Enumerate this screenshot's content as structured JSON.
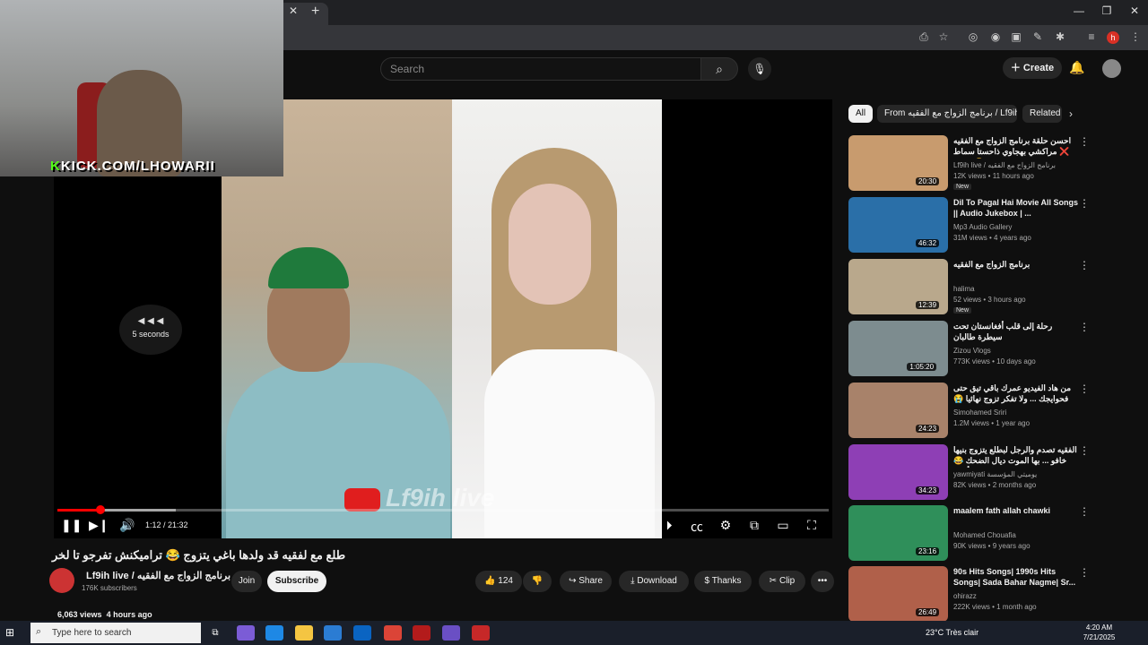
{
  "browser": {
    "tab_close": "✕",
    "new_tab": "+",
    "min": "—",
    "restore": "❐",
    "close": "✕",
    "profile_initial": "h"
  },
  "header": {
    "search_placeholder": "Search",
    "create_label": "Create"
  },
  "webcam": {
    "label_k": "K",
    "label_rest": "KICK.COM/LHOWARII"
  },
  "player": {
    "watermark": "Lf9ih live",
    "seek_arrows": "◀ ◀ ◀",
    "seek_label": "5 seconds",
    "time": "1:12 / 21:32",
    "progress_played": 0.056,
    "progress_buffered": 0.154
  },
  "video": {
    "title": "طلع مع لفقيه قد ولدها باغي يتزوج 😂 تراميكنش تفرجو تا لخر",
    "channel_name": "Lf9ih live / برنامج الزواج مع الفقيه",
    "subscribers": "176K subscribers",
    "join_label": "Join",
    "subscribe_label": "Subscribe",
    "likes": "124",
    "share_label": "Share",
    "download_label": "Download",
    "thanks_label": "Thanks",
    "clip_label": "Clip",
    "more_label": "•••",
    "views": "6,063 views",
    "age": "4 hours ago"
  },
  "sidebar": {
    "chips": [
      {
        "label": "All"
      },
      {
        "label": "From برنامج الزواج مع الفقيه / Lf9ih live"
      },
      {
        "label": "Related"
      }
    ],
    "recommendations": [
      {
        "title": "احسن حلقة برنامج الزواج مع الفقيه ❌ مراكشي بهجاوي ذاحستا سماط طاخر 😂",
        "channel": "Lf9ih live / برنامج الزواج مع الفقيه",
        "meta": "12K views • 11 hours ago",
        "badge": "New",
        "duration": "20:30",
        "color": "#c89b6e"
      },
      {
        "title": "Dil To Pagal Hai Movie All Songs || Audio Jukebox | ...",
        "channel": "Mp3 Audio Gallery",
        "meta": "31M views • 4 years ago",
        "badge": "",
        "duration": "46:32",
        "color": "#2a6fa8"
      },
      {
        "title": "برنامج الزواج مع الفقيه",
        "channel": "halima",
        "meta": "52 views • 3 hours ago",
        "badge": "New",
        "duration": "12:39",
        "color": "#b9a88c"
      },
      {
        "title": "رحلة إلى قلب أفغانستان تحت سيطرة طالبان",
        "channel": "Zizou Vlogs",
        "meta": "773K views • 10 days ago",
        "badge": "",
        "duration": "1:05:20",
        "color": "#7d8c8f"
      },
      {
        "title": "من هاد الفيديو عمرك باقي تيق حتى فحوايجك ... ولا تفكر تزوج نهائيا 😭 حسبيا الله ونعم",
        "channel": "Simohamed Sriri",
        "meta": "1.2M views • 1 year ago",
        "badge": "",
        "duration": "24:23",
        "color": "#a8826a"
      },
      {
        "title": "الفقيه تصدم والرجل لبطلع يتزوج بنيها خافو ... بها الموت ديال الضحك 😂 كمالو الفيديو أمثلة",
        "channel": "yawmiyati يوميتي المؤسسة",
        "meta": "82K views • 2 months ago",
        "badge": "",
        "duration": "34:23",
        "color": "#8e3fb5"
      },
      {
        "title": "maalem fath allah chawki",
        "channel": "Mohamed Chouafia",
        "meta": "90K views • 9 years ago",
        "badge": "",
        "duration": "23:16",
        "color": "#2f8f5a"
      },
      {
        "title": "90s Hits Songs| 1990s Hits Songs| Sada Bahar Nagme| Sr...",
        "channel": "ohirazz",
        "meta": "222K views • 1 month ago",
        "badge": "",
        "duration": "26:49",
        "color": "#b0604a"
      }
    ],
    "menu_dots": "⋮"
  },
  "taskbar": {
    "search_placeholder": "Type here to search",
    "weather": "23°C  Très clair",
    "time": "4:20 AM",
    "date": "7/21/2025"
  }
}
